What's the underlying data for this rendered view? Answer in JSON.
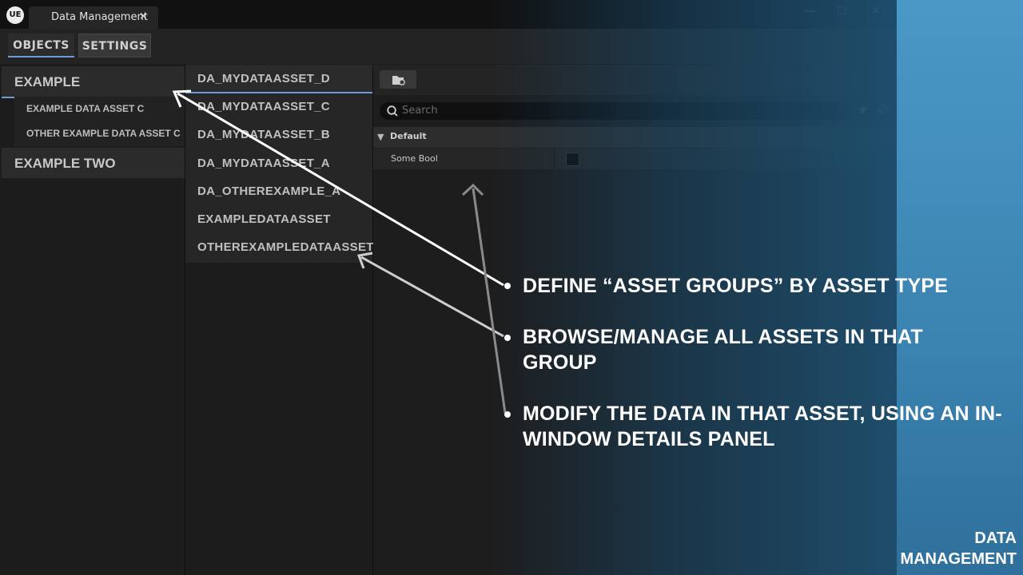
{
  "window": {
    "logo": "UE",
    "tab_title": "Data Management",
    "tab_close": "×",
    "controls": {
      "minimize": "—",
      "maximize": "☐",
      "close": "✕"
    }
  },
  "toolbar": {
    "tabs": [
      {
        "label": "OBJECTS"
      },
      {
        "label": "SETTINGS"
      }
    ]
  },
  "groups": [
    {
      "label": "EXAMPLE",
      "items": [
        "EXAMPLE DATA ASSET C",
        "OTHER EXAMPLE DATA ASSET C"
      ]
    },
    {
      "label": "EXAMPLE TWO"
    }
  ],
  "assets": [
    "DA_MYDATAASSET_D",
    "DA_MYDATAASSET_C",
    "DA_MYDATAASSET_B",
    "DA_MYDATAASSET_A",
    "DA_OTHEREXAMPLE_A",
    "EXAMPLEDATAASSET",
    "OTHEREXAMPLEDATAASSET"
  ],
  "details": {
    "search_placeholder": "Search",
    "category": "Default",
    "property": {
      "label": "Some Bool",
      "checked": false
    }
  },
  "callouts": [
    "DEFINE “ASSET GROUPS” BY ASSET TYPE",
    "BROWSE/MANAGE ALL ASSETS IN THAT GROUP",
    "MODIFY THE DATA IN THAT ASSET, USING AN IN-WINDOW DETAILS PANEL"
  ],
  "brand": {
    "line1": "DATA",
    "line2": "MANAGEMENT"
  },
  "icons": [
    "unreal-logo-icon",
    "close-icon",
    "minimize-icon",
    "maximize-icon",
    "folder-browse-icon",
    "search-icon",
    "star-icon",
    "gear-icon",
    "collapse-triangle-icon"
  ],
  "colors": {
    "accent": "#6f9bd4",
    "brand_blue": "#4a98c6"
  }
}
